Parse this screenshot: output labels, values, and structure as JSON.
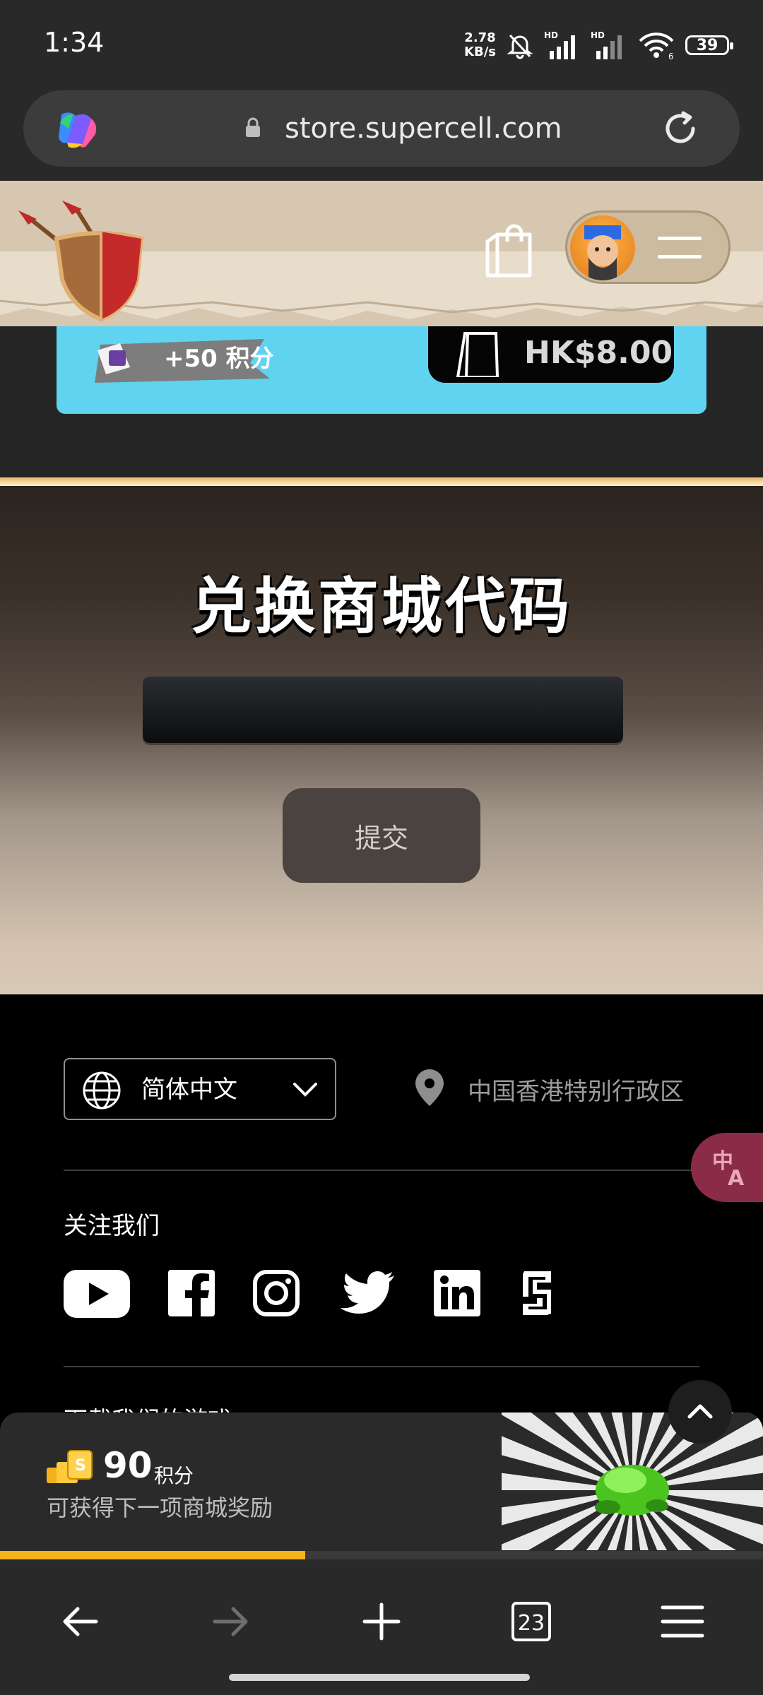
{
  "status_bar": {
    "time": "1:34",
    "net_speed_value": "2.78",
    "net_speed_unit": "KB/s",
    "signal1_label": "HD",
    "signal2_label": "HD",
    "wifi_label": "6",
    "battery": "39"
  },
  "browser": {
    "url": "store.supercell.com"
  },
  "header": {
    "game_logo": "clash-of-clans-shield",
    "cart_icon": "shopping-bag-icon"
  },
  "offer": {
    "points_label": "+50 积分",
    "price": "HK$8.00"
  },
  "redeem": {
    "title": "兑换商城代码",
    "input_value": "",
    "submit_label": "提交"
  },
  "footer": {
    "language": "简体中文",
    "region": "中国香港特别行政区",
    "follow_title": "关注我们",
    "social": [
      "youtube-icon",
      "facebook-icon",
      "instagram-icon",
      "twitter-icon",
      "linkedin-icon",
      "supercell-icon"
    ],
    "games_header": "下载我们的游戏"
  },
  "rewards": {
    "points": "90",
    "points_unit": "积分",
    "next_reward_text": "可获得下一项商城奖励",
    "progress_fraction": 0.4
  },
  "nav": {
    "tab_count": "23"
  },
  "colors": {
    "accent_gold": "#f6b21a",
    "offer_blue": "#5fd3f0",
    "translate_bubble": "#8a2b48"
  }
}
